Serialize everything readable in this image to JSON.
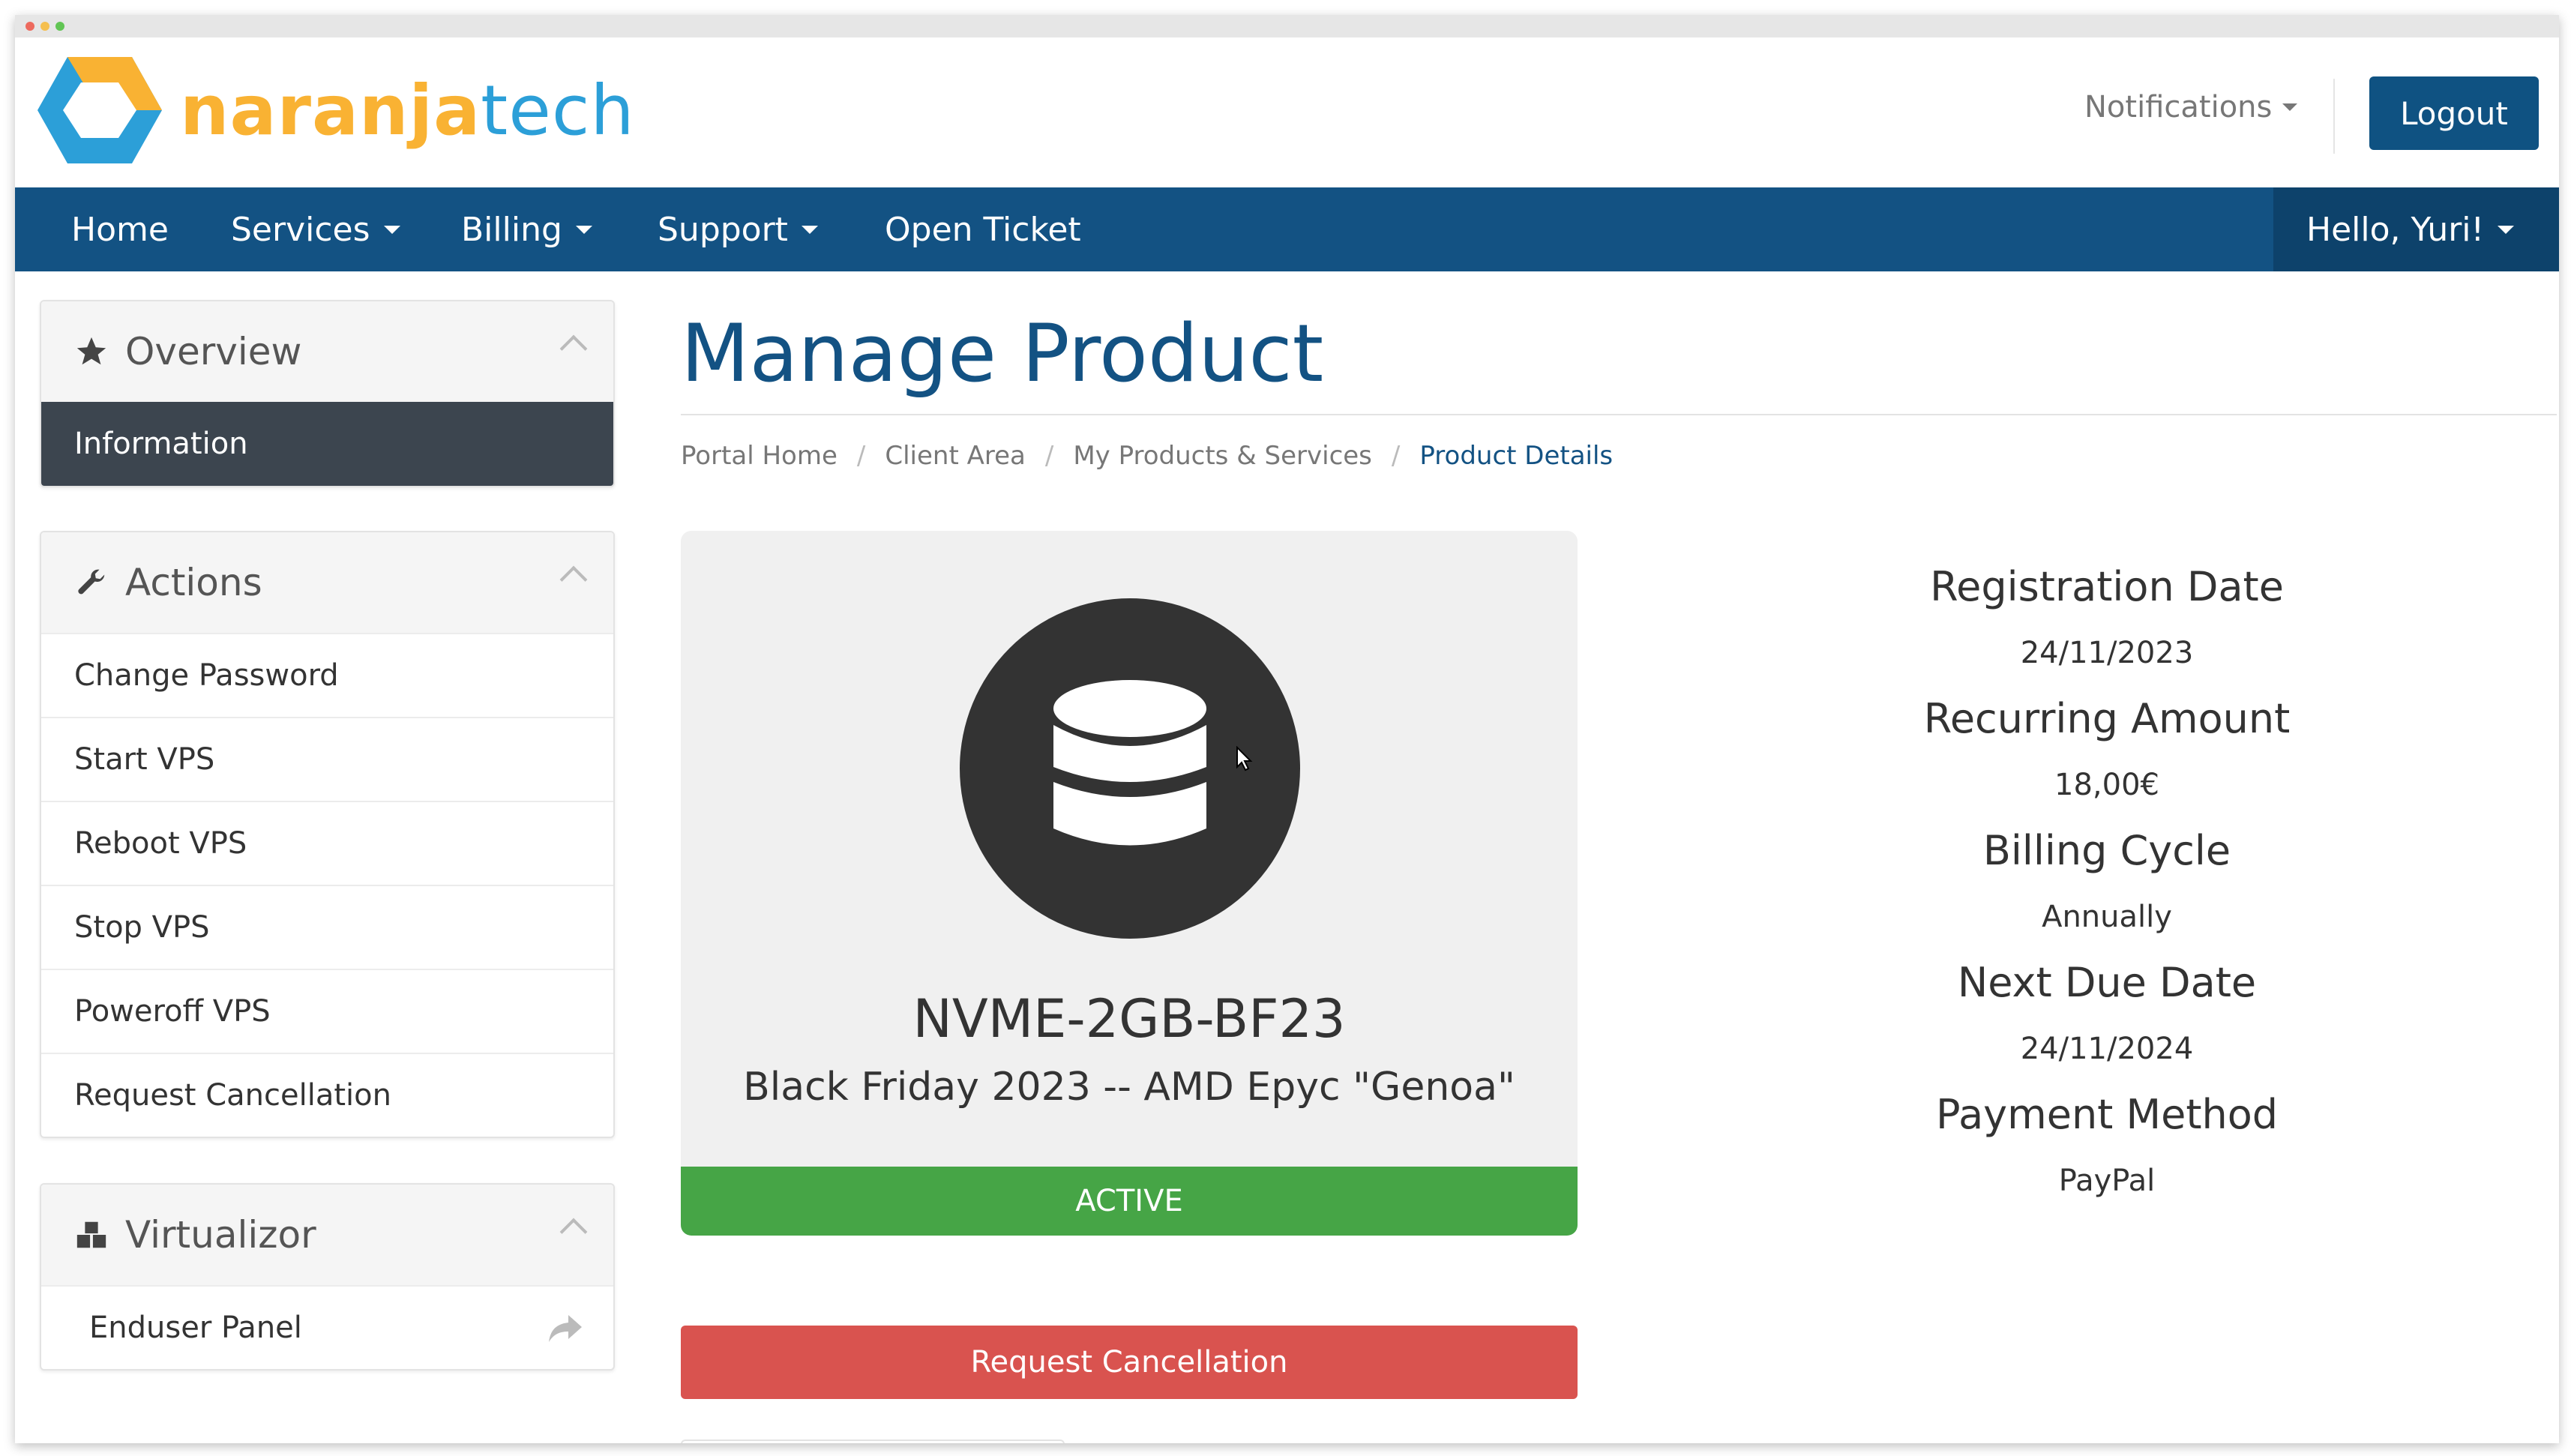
{
  "brand": {
    "logo_text_a": "naranja",
    "logo_text_b": "tech"
  },
  "header": {
    "notifications_label": "Notifications",
    "logout_label": "Logout"
  },
  "nav": {
    "items": [
      {
        "label": "Home"
      },
      {
        "label": "Services"
      },
      {
        "label": "Billing"
      },
      {
        "label": "Support"
      },
      {
        "label": "Open Ticket"
      }
    ],
    "user_greeting": "Hello, Yuri!"
  },
  "sidebar": {
    "overview": {
      "title": "Overview",
      "items": [
        {
          "label": "Information"
        }
      ]
    },
    "actions": {
      "title": "Actions",
      "items": [
        {
          "label": "Change Password"
        },
        {
          "label": "Start VPS"
        },
        {
          "label": "Reboot VPS"
        },
        {
          "label": "Stop VPS"
        },
        {
          "label": "Poweroff VPS"
        },
        {
          "label": "Request Cancellation"
        }
      ]
    },
    "virtualizor": {
      "title": "Virtualizor",
      "items": [
        {
          "label": "Enduser Panel"
        }
      ]
    }
  },
  "main": {
    "title": "Manage Product",
    "breadcrumb": [
      "Portal Home",
      "Client Area",
      "My Products & Services",
      "Product Details"
    ],
    "product": {
      "name": "NVME-2GB-BF23",
      "description": "Black Friday 2023 -- AMD Epyc \"Genoa\"",
      "status": "ACTIVE",
      "icon": "database-icon"
    },
    "cancel_button": "Request Cancellation",
    "details": [
      {
        "label": "Registration Date",
        "value": "24/11/2023"
      },
      {
        "label": "Recurring Amount",
        "value": "18,00€"
      },
      {
        "label": "Billing Cycle",
        "value": "Annually"
      },
      {
        "label": "Next Due Date",
        "value": "24/11/2024"
      },
      {
        "label": "Payment Method",
        "value": "PayPal"
      }
    ]
  },
  "colors": {
    "primary": "#135283",
    "nav_user_bg": "#0d426b",
    "active_item_bg": "#3c454f",
    "status_green": "#46a546",
    "danger_red": "#d9534f",
    "logo_orange": "#f9b233",
    "logo_blue": "#2c9fd8"
  }
}
